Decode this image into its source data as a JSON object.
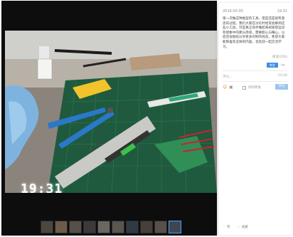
{
  "photo": {
    "time_overlay": "19:31",
    "date_overlay": "2016-05-05"
  },
  "thumbnails": [
    {
      "color": "#4b4640"
    },
    {
      "color": "#6d5a49"
    },
    {
      "color": "#55504a"
    },
    {
      "color": "#3c3a38"
    },
    {
      "color": "#6a6660"
    },
    {
      "color": "#595550"
    },
    {
      "color": "#2f3a44"
    },
    {
      "color": "#45403a"
    },
    {
      "color": "#5a4f48"
    },
    {
      "color": "#3f4650"
    }
  ],
  "post": {
    "date": "2016-05-05",
    "time": "19:31",
    "text": "第一次做这种类型的工具，但是还是很有意思的过程。我们大家在讨论时经常会聊到这些小工具，可是真正动手做起来却发现远没有想象中的那么简单，需要耐心与细心。以后还会继续分享更多的制作经验，希望大家能够喜欢这样的内容，也欢迎一起交流学习。",
    "views": "阅读(256)",
    "mini_button": "转发",
    "share_glyph": "↪"
  },
  "comment": {
    "placeholder": "评论…",
    "counter": "0/140",
    "smile_glyph": "☺",
    "image_glyph": "▣",
    "checkbox_label": "同时转发",
    "publish_label": "评论"
  },
  "footer": {
    "like_label": "赞",
    "collect_label": "收藏",
    "like_glyph": "♡",
    "collect_glyph": "☆"
  },
  "colors": {
    "viewer_bg": "#0d0d0d",
    "accent": "#3d8ee8",
    "cutting_mat": "#1f5a3e"
  }
}
